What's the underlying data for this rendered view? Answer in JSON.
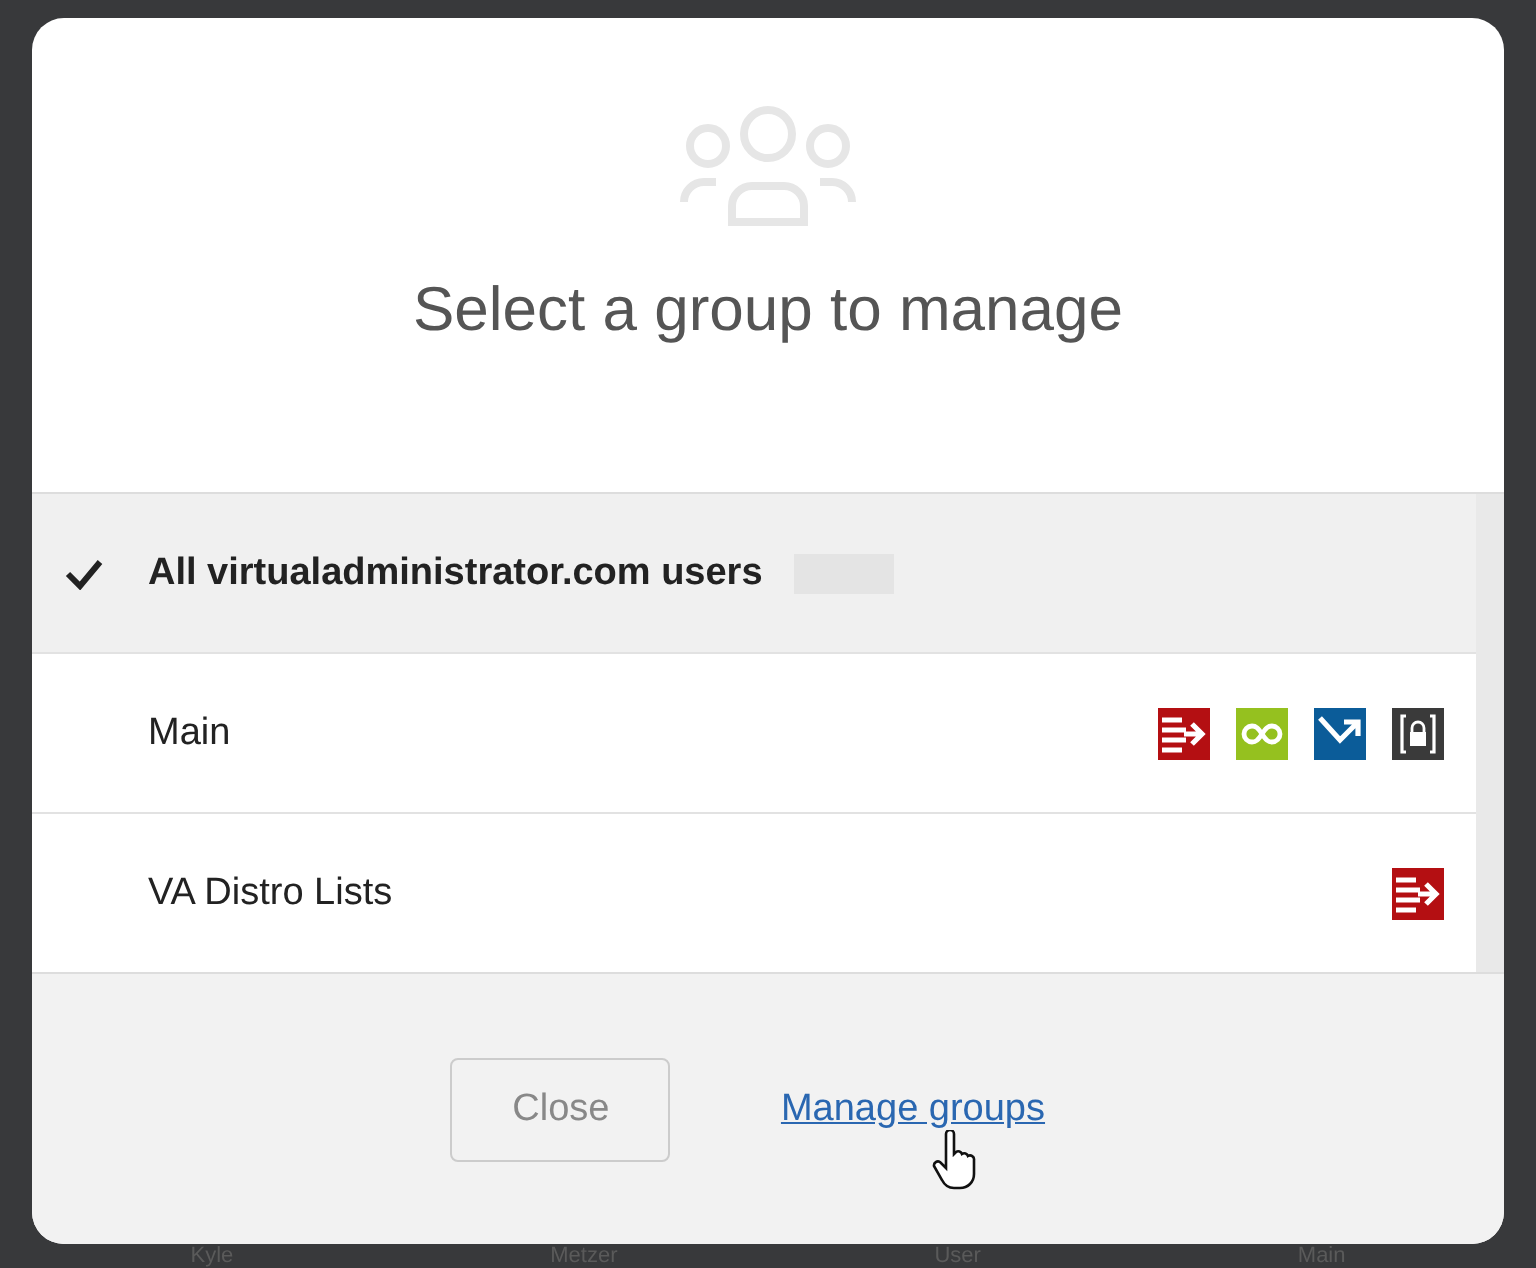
{
  "dialog": {
    "title": "Select a group to manage",
    "groups": [
      {
        "name": "All virtualadministrator.com users",
        "selected": true
      },
      {
        "name": "Main",
        "selected": false,
        "services": [
          {
            "kind": "forward",
            "color": "#b40f12"
          },
          {
            "kind": "infinity",
            "color": "#95c11f"
          },
          {
            "kind": "diagonal",
            "color": "#0b5c99"
          },
          {
            "kind": "archive",
            "color": "#3a3a3a"
          }
        ]
      },
      {
        "name": "VA Distro Lists",
        "selected": false,
        "services": [
          {
            "kind": "forward",
            "color": "#b40f12"
          }
        ]
      }
    ],
    "close_button": "Close",
    "manage_link": "Manage groups"
  },
  "background_row": [
    "Kyle",
    "Metzer",
    "User",
    "Main"
  ]
}
